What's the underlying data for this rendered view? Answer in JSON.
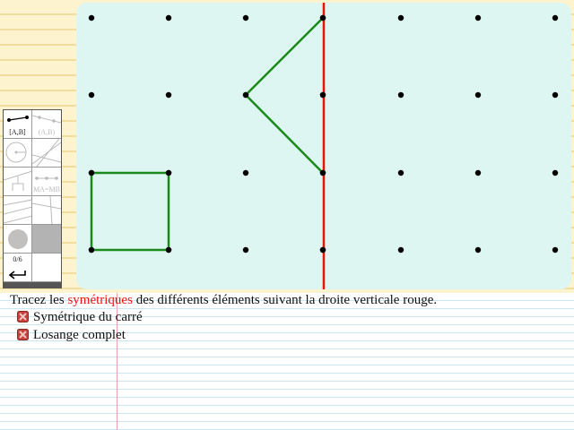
{
  "toolbar": {
    "tools": [
      {
        "name": "segment-tool",
        "label": "[A,B]",
        "enabled": true
      },
      {
        "name": "line-tool",
        "label": "(A,B)",
        "enabled": false
      },
      {
        "name": "circle-tool",
        "label": "",
        "enabled": false
      },
      {
        "name": "lines-tool",
        "label": "",
        "enabled": false
      },
      {
        "name": "perpendicular-tool",
        "label": "",
        "enabled": false
      },
      {
        "name": "midpoint-tool",
        "label": "MA=MB",
        "enabled": false
      },
      {
        "name": "intersection-tool",
        "label": "",
        "enabled": false
      },
      {
        "name": "compass-tool",
        "label": "",
        "enabled": false
      },
      {
        "name": "color-tool",
        "label": "",
        "enabled": true
      },
      {
        "name": "fill-tool",
        "label": "",
        "enabled": false
      }
    ],
    "progress": "0/6"
  },
  "instruction": {
    "before": "Tracez les ",
    "highlight": "symétriques",
    "after": " des différents éléments suivant la droite verticale rouge."
  },
  "tasks": [
    {
      "label": "Symétrique du carré",
      "status": "incomplete"
    },
    {
      "label": "Losange complet",
      "status": "incomplete"
    }
  ],
  "colors": {
    "axis": "#e8130e",
    "shape": "#1a8a1a",
    "board": "#ddf6f2",
    "highlight": "#e8130e"
  }
}
